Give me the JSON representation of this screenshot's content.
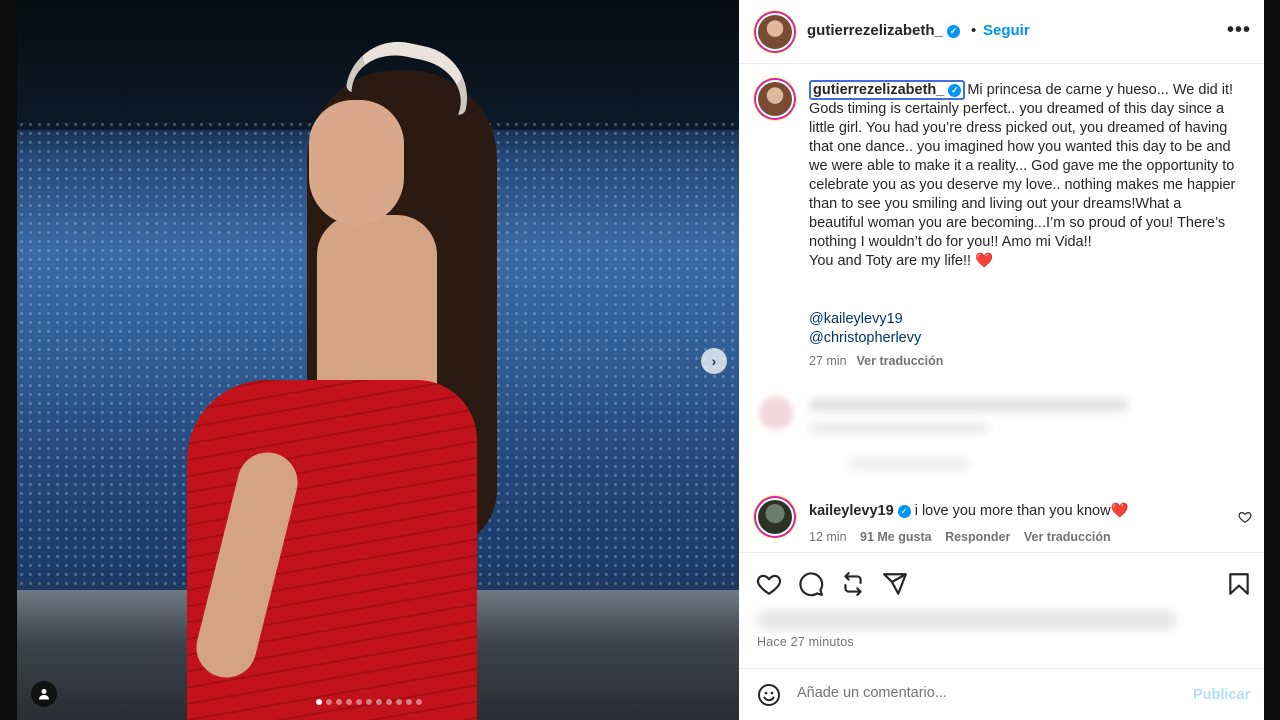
{
  "header": {
    "username": "gutierrezelizabeth_",
    "separator": "•",
    "follow_label": "Seguir",
    "more_icon": "more-horizontal-icon"
  },
  "caption": {
    "username": "gutierrezelizabeth_",
    "text": "Mi princesa de carne y hueso... We did it! Gods timing is certainly perfect.. you dreamed of this day since a little girl. You had you’re dress picked out, you dreamed of having that one dance.. you imagined how you wanted this day to be and we were able to make it a reality... God gave me the opportunity to celebrate you as you deserve my love.. nothing makes me happier than to see you smiling and living out your dreams!What a beautiful woman you are becoming...I’m so proud of you! There’s nothing I wouldn’t do for you!! Amo mi Vida!!\nYou and Toty are my life!! ",
    "heart": "❤️",
    "mentions": [
      "@kaileylevy19",
      "@christopherlevy"
    ],
    "time": "27 min",
    "translate_label": "Ver traducción"
  },
  "comment": {
    "username": "kaileylevy19",
    "text": " i love you more than you know",
    "heart": "❤️",
    "time": "12 min",
    "likes": "91 Me gusta",
    "reply_label": "Responder",
    "translate_label": "Ver traducción"
  },
  "post": {
    "time_ago": "Hace 27 minutos",
    "comment_placeholder": "Añade un comentario...",
    "publish_label": "Publicar"
  },
  "media": {
    "carousel_count": 11,
    "carousel_active": 0
  },
  "colors": {
    "accent": "#0095f6",
    "verified": "#0095f6",
    "mention": "#00376b",
    "muted": "#737373"
  }
}
